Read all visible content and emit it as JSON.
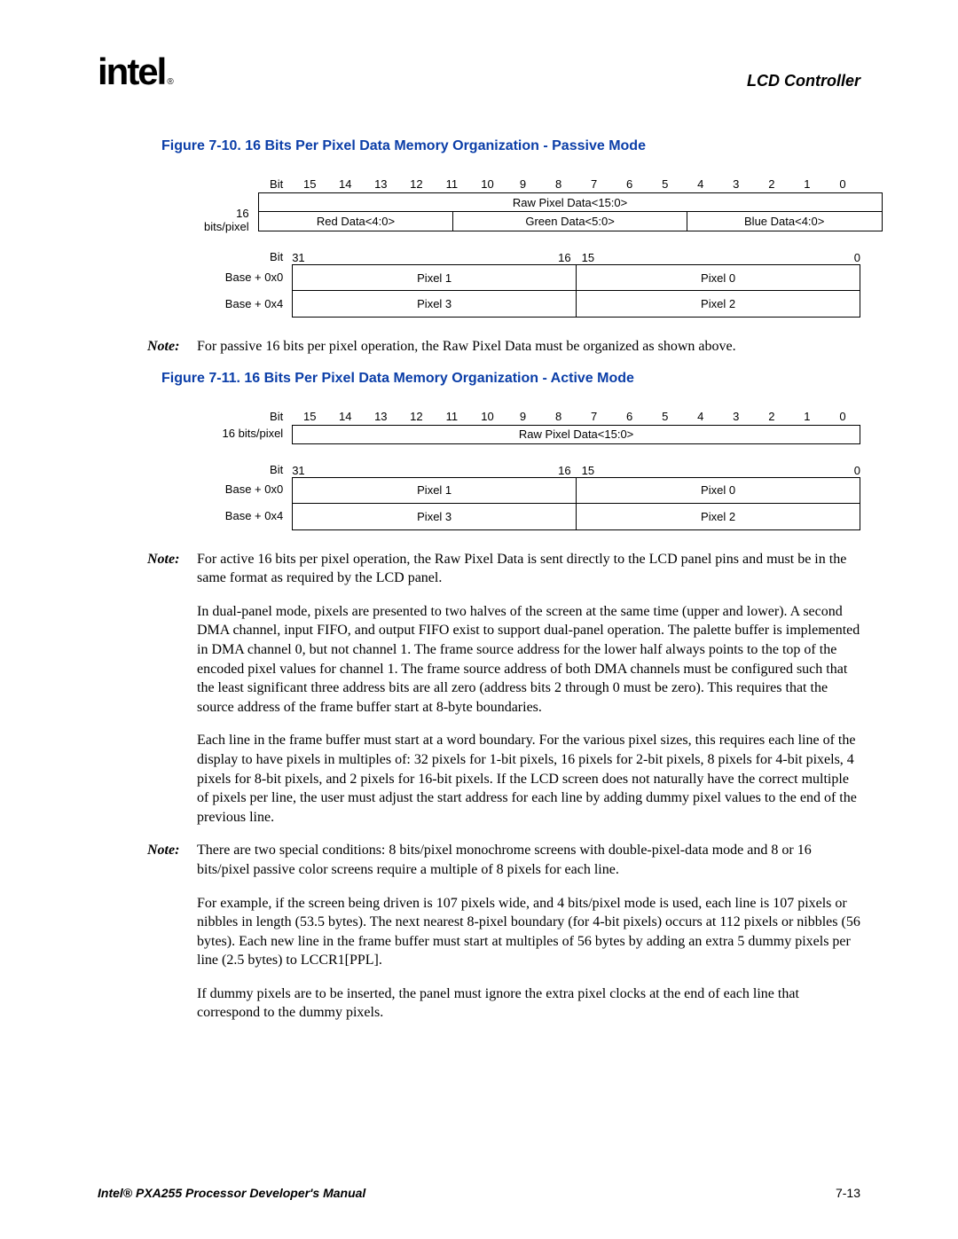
{
  "header": {
    "logo_text": "intel",
    "logo_sub": "®",
    "section": "LCD Controller"
  },
  "figure10": {
    "title": "Figure 7-10. 16 Bits Per Pixel Data Memory Organization - Passive Mode",
    "bit_label": "Bit",
    "bits16": [
      "15",
      "14",
      "13",
      "12",
      "11",
      "10",
      "9",
      "8",
      "7",
      "6",
      "5",
      "4",
      "3",
      "2",
      "1",
      "0"
    ],
    "row16_label": "16 bits/pixel",
    "raw_pixel": "Raw Pixel Data<15:0>",
    "red": "Red Data<4:0>",
    "green": "Green Data<5:0>",
    "blue": "Blue Data<4:0>",
    "bits32": {
      "b31": "31",
      "b16": "16",
      "b15": "15",
      "b0": "0"
    },
    "base0": "Base + 0x0",
    "base4": "Base + 0x4",
    "p1": "Pixel 1",
    "p0": "Pixel 0",
    "p3": "Pixel 3",
    "p2": "Pixel 2"
  },
  "note1": {
    "label": "Note:",
    "text": "For passive 16 bits per pixel operation, the Raw Pixel Data must be organized as shown above."
  },
  "figure11": {
    "title": "Figure 7-11. 16 Bits Per Pixel Data Memory Organization - Active Mode",
    "bit_label": "Bit",
    "bits16": [
      "15",
      "14",
      "13",
      "12",
      "11",
      "10",
      "9",
      "8",
      "7",
      "6",
      "5",
      "4",
      "3",
      "2",
      "1",
      "0"
    ],
    "row16_label": "16 bits/pixel",
    "raw_pixel": "Raw Pixel Data<15:0>",
    "bits32": {
      "b31": "31",
      "b16": "16",
      "b15": "15",
      "b0": "0"
    },
    "base0": "Base + 0x0",
    "base4": "Base + 0x4",
    "p1": "Pixel 1",
    "p0": "Pixel 0",
    "p3": "Pixel 3",
    "p2": "Pixel 2"
  },
  "note2": {
    "label": "Note:",
    "text": "For active 16 bits per pixel operation, the Raw Pixel Data is sent directly to the LCD panel pins and must be in the same format as required by the LCD panel."
  },
  "para1": "In dual-panel mode, pixels are presented to two halves of the screen at the same time (upper and lower). A second DMA channel, input FIFO, and output FIFO exist to support dual-panel operation. The palette buffer is implemented in DMA channel 0, but not channel 1. The frame source address for the lower half always points to the top of the encoded pixel values for channel 1. The frame source address of both DMA channels must be configured such that the least significant three address bits are all zero (address bits 2 through 0 must be zero). This requires that the source address of the frame buffer start at 8-byte boundaries.",
  "para2": "Each line in the frame buffer must start at a word boundary. For the various pixel sizes, this requires each line of the display to have pixels in multiples of: 32 pixels for 1-bit pixels, 16 pixels for 2-bit pixels, 8 pixels for 4-bit pixels, 4 pixels for 8-bit pixels, and 2 pixels for 16-bit pixels. If the LCD screen does not naturally have the correct multiple of pixels per line, the user must adjust the start address for each line by adding dummy pixel values to the end of the previous line.",
  "note3": {
    "label": "Note:",
    "text": "There are two special conditions: 8 bits/pixel monochrome screens with double-pixel-data mode and 8 or 16 bits/pixel passive color screens require a multiple of 8 pixels for each line."
  },
  "para3": "For example, if the screen being driven is 107 pixels wide, and 4 bits/pixel mode is used, each line is 107 pixels or nibbles in length (53.5 bytes). The next nearest 8-pixel boundary (for 4-bit pixels) occurs at 112 pixels or nibbles (56 bytes). Each new line in the frame buffer must start at multiples of 56 bytes by adding an extra 5 dummy pixels per line (2.5 bytes) to LCCR1[PPL].",
  "para4": "If dummy pixels are to be inserted, the panel must ignore the extra pixel clocks at the end of each line that correspond to the dummy pixels.",
  "footer": {
    "left": "Intel® PXA255 Processor Developer's Manual",
    "right": "7-13"
  }
}
